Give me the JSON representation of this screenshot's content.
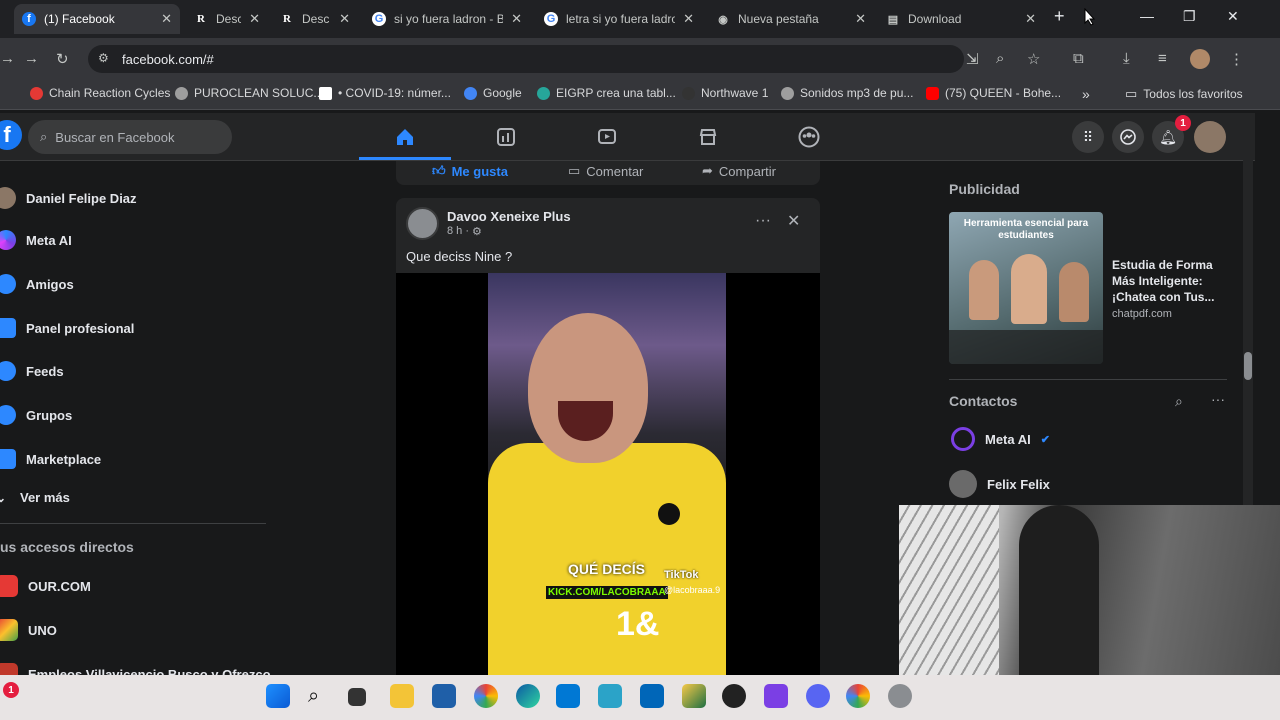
{
  "tabs": [
    {
      "title": "(1) Facebook",
      "fav": "f",
      "fav_color": "#1877f2",
      "active": true
    },
    {
      "title": "Desc",
      "fav": "R"
    },
    {
      "title": "Desc",
      "fav": "R"
    },
    {
      "title": "si yo fuera ladron - B",
      "fav": "G"
    },
    {
      "title": "letra si yo fuera ladro",
      "fav": "G"
    },
    {
      "title": "Nueva pestaña",
      "fav": "◉"
    },
    {
      "title": "Download",
      "fav": "▤"
    }
  ],
  "address": {
    "url": "facebook.com/#"
  },
  "bookmarks": [
    {
      "label": "Chain Reaction Cycles",
      "color": "#e53935"
    },
    {
      "label": "PUROCLEAN SOLUC...",
      "color": "#9e9e9e"
    },
    {
      "label": "• COVID-19: númer...",
      "color": "#ffffff"
    },
    {
      "label": "Google",
      "color": "#4285f4"
    },
    {
      "label": "EIGRP crea una tabl...",
      "color": "#26a69a"
    },
    {
      "label": "Northwave 1",
      "color": "#333333"
    },
    {
      "label": "Sonidos mp3 de pu...",
      "color": "#9e9e9e"
    },
    {
      "label": "(75) QUEEN - Bohe...",
      "color": "#ff0000"
    }
  ],
  "bookmarks_more": "»",
  "all_favorites": "Todos los favoritos",
  "fb": {
    "logo": "f",
    "search_placeholder": "Buscar en Facebook",
    "notif_count": "1"
  },
  "left_nav": [
    {
      "label": "Daniel Felipe Diaz",
      "color": "#8b7766"
    },
    {
      "label": "Meta AI",
      "color": "#7b3fe4"
    },
    {
      "label": "Amigos",
      "color": "#2d88ff"
    },
    {
      "label": "Panel profesional",
      "color": "#2d88ff"
    },
    {
      "label": "Feeds",
      "color": "#2d88ff"
    },
    {
      "label": "Grupos",
      "color": "#2d88ff"
    },
    {
      "label": "Marketplace",
      "color": "#2d88ff"
    }
  ],
  "see_more": "Ver más",
  "shortcuts_title": "us accesos directos",
  "shortcuts": [
    {
      "label": "OUR.COM",
      "color": "#e53935"
    },
    {
      "label": "UNO",
      "color": "#e53935"
    },
    {
      "label": "Empleos Villavicencio Busco y Ofrezco",
      "color": "#c0392b"
    }
  ],
  "prev_post_actions": {
    "like": "Me gusta",
    "comment": "Comentar",
    "share": "Compartir"
  },
  "post": {
    "author": "Davoo Xeneixe Plus",
    "time": "8 h ·",
    "text": "Que deciss Nine ?",
    "overlay_line1": "QUÉ DECÍS",
    "overlay_line2": "KICK.COM/LACOBRAAA",
    "tiktok": "TikTok",
    "tiktok_handle": "@lacobraaa.9",
    "jersey_number": "1&"
  },
  "right": {
    "ads_title": "Publicidad",
    "ad_img_title": "Herramienta esencial para estudiantes",
    "ad_headline": "Estudia de Forma Más Inteligente: ¡Chatea con Tus...",
    "ad_domain": "chatpdf.com",
    "contacts_title": "Contactos",
    "contacts": [
      {
        "name": "Meta AI",
        "color": "#7b3fe4"
      },
      {
        "name": "Felix Felix",
        "color": "#6a6a6a"
      }
    ]
  },
  "taskbar_badge": "1"
}
